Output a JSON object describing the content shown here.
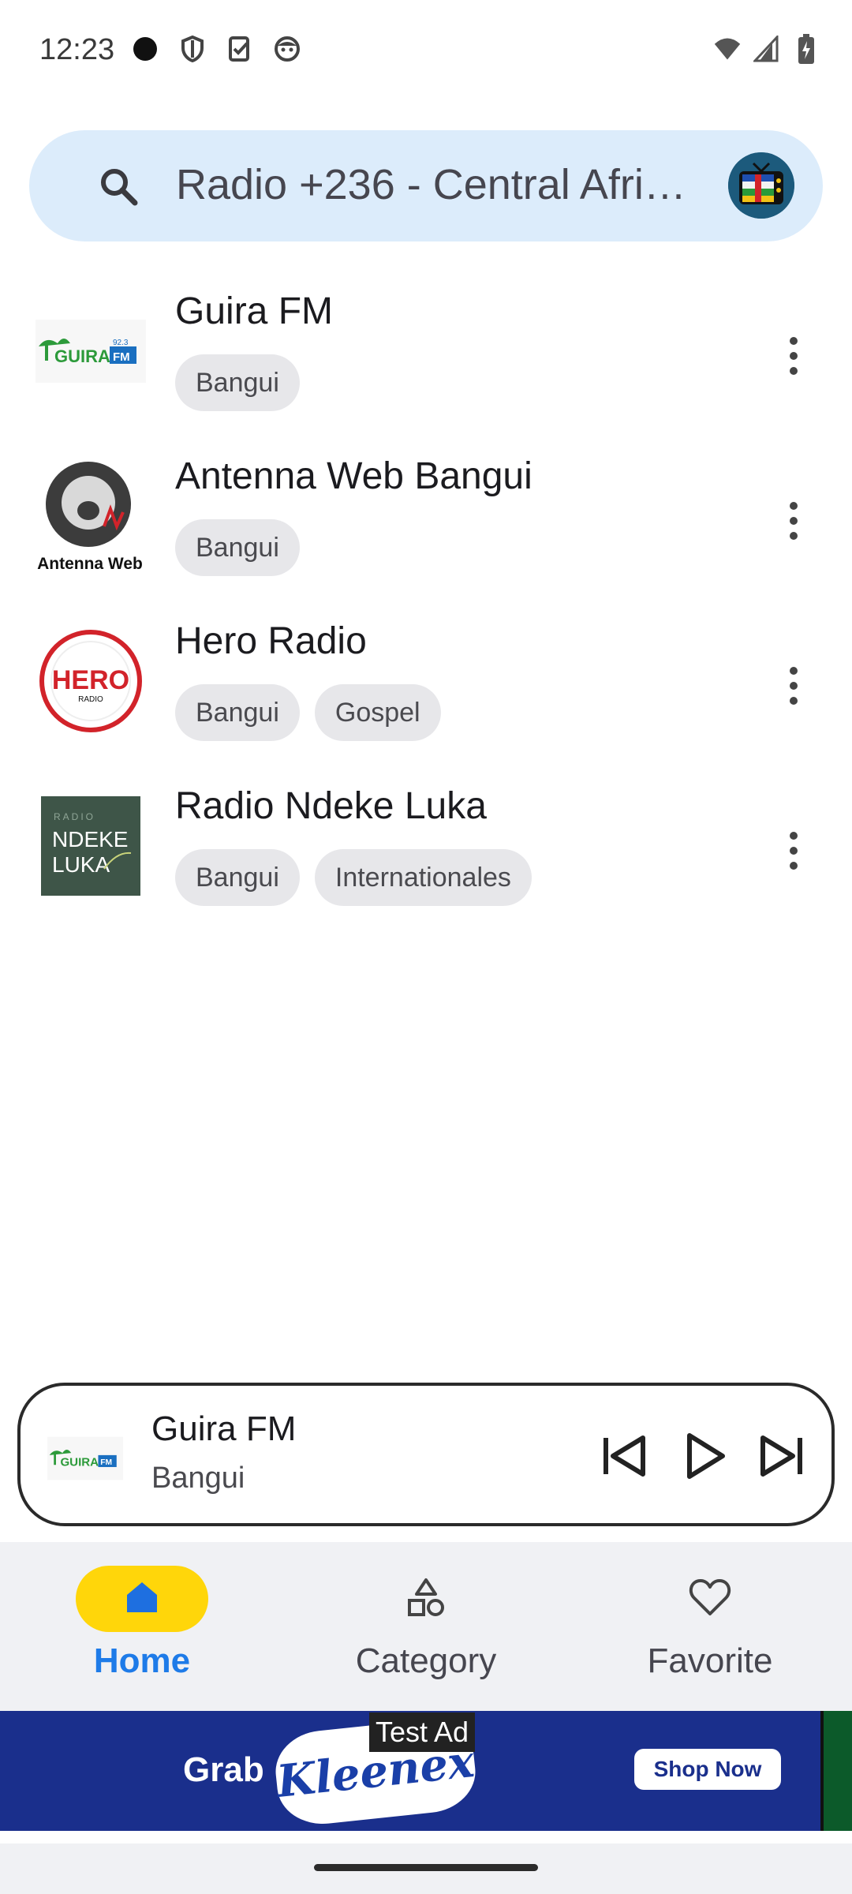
{
  "status_bar": {
    "time": "12:23",
    "icons_left": [
      "record-dot-icon",
      "shield-icon",
      "task-check-icon",
      "face-icon"
    ],
    "icons_right": [
      "wifi-icon",
      "signal-icon",
      "battery-charging-icon"
    ]
  },
  "search": {
    "text": "Radio +236 - Central Afri…",
    "icon": "search-icon",
    "avatar_icon": "tv-flag-icon"
  },
  "stations": [
    {
      "name": "Guira FM",
      "tags": [
        "Bangui"
      ],
      "logo": "guira-fm-logo"
    },
    {
      "name": "Antenna Web Bangui",
      "tags": [
        "Bangui"
      ],
      "logo": "antenna-web-logo",
      "logo_caption": "Antenna Web"
    },
    {
      "name": "Hero Radio",
      "tags": [
        "Bangui",
        "Gospel"
      ],
      "logo": "hero-radio-logo"
    },
    {
      "name": "Radio Ndeke Luka",
      "tags": [
        "Bangui",
        "Internationales"
      ],
      "logo": "ndeke-luka-logo"
    }
  ],
  "player": {
    "title": "Guira FM",
    "subtitle": "Bangui"
  },
  "nav": {
    "items": [
      {
        "label": "Home",
        "icon": "home-icon",
        "active": true
      },
      {
        "label": "Category",
        "icon": "category-icon",
        "active": false
      },
      {
        "label": "Favorite",
        "icon": "heart-icon",
        "active": false
      }
    ]
  },
  "ad": {
    "test_label": "Test Ad",
    "grab_text": "Grab",
    "brand": "Kleenex",
    "cta": "Shop Now"
  },
  "colors": {
    "search_bg": "#dcecfb",
    "active_pill": "#ffd60a",
    "active_label": "#1e7be8",
    "chip_bg": "#e7e7ea",
    "ad_bg": "#1a2f8c"
  }
}
